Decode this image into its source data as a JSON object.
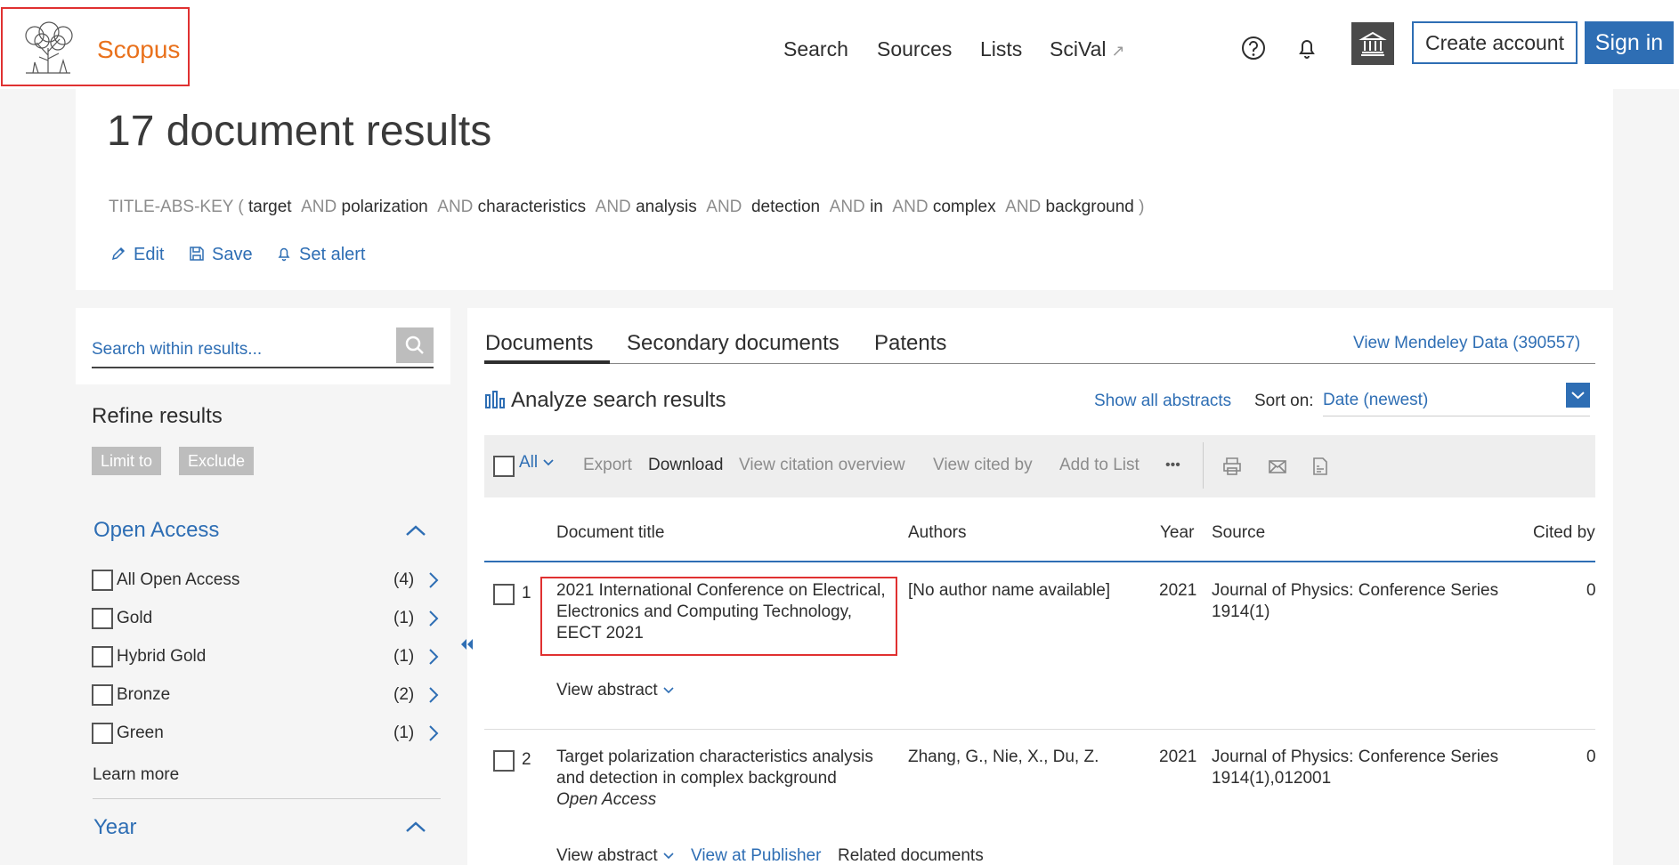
{
  "header": {
    "logo_text": "Scopus",
    "nav": [
      {
        "label": "Search"
      },
      {
        "label": "Sources"
      },
      {
        "label": "Lists"
      },
      {
        "label": "SciVal",
        "external": "↗"
      }
    ],
    "create_account": "Create account",
    "sign_in": "Sign in",
    "icons": [
      "help-icon",
      "bell-icon",
      "institution-icon"
    ]
  },
  "results": {
    "title": "17 document results",
    "query": {
      "field": "TITLE-ABS-KEY (",
      "terms": [
        "target",
        "polarization",
        "characteristics",
        "analysis",
        "detection",
        "in",
        "complex",
        "background"
      ],
      "op": "AND",
      "close": ")"
    },
    "actions": {
      "edit": "Edit",
      "save": "Save",
      "set_alert": "Set alert"
    }
  },
  "sidebar": {
    "search_placeholder": "Search within results...",
    "refine_title": "Refine results",
    "limit_to": "Limit to",
    "exclude": "Exclude",
    "open_access": {
      "title": "Open Access",
      "items": [
        {
          "label": "All Open Access",
          "count": "(4)"
        },
        {
          "label": "Gold",
          "count": "(1)"
        },
        {
          "label": "Hybrid Gold",
          "count": "(1)"
        },
        {
          "label": "Bronze",
          "count": "(2)"
        },
        {
          "label": "Green",
          "count": "(1)"
        }
      ],
      "learn_more": "Learn more"
    },
    "year_title": "Year"
  },
  "main": {
    "tabs": [
      {
        "label": "Documents"
      },
      {
        "label": "Secondary documents"
      },
      {
        "label": "Patents"
      }
    ],
    "mendeley": "View Mendeley Data (390557)",
    "analyze": "Analyze search results",
    "show_all_abstracts": "Show all abstracts",
    "sort_label": "Sort on:",
    "sort_value": "Date (newest)",
    "toolbar": {
      "all": "All",
      "export": "Export",
      "download": "Download",
      "view_citation": "View citation overview",
      "view_cited_by": "View cited by",
      "add_to_list": "Add to List",
      "more": "•••"
    },
    "columns": {
      "title": "Document title",
      "authors": "Authors",
      "year": "Year",
      "source": "Source",
      "cited_by": "Cited by"
    },
    "rows": [
      {
        "num": "1",
        "title_lines": [
          "2021 International Conference on Electrical,",
          "Electronics and Computing Technology,",
          "EECT 2021"
        ],
        "authors": "[No author name available]",
        "year": "2021",
        "source_lines": [
          "Journal of Physics: Conference Series",
          "1914(1)"
        ],
        "cited": "0",
        "view_abstract": "View abstract"
      },
      {
        "num": "2",
        "title_lines": [
          "Target polarization characteristics analysis",
          "and detection in complex background"
        ],
        "open_access": "Open Access",
        "authors": "Zhang, G., Nie, X., Du, Z.",
        "year": "2021",
        "source_lines": [
          "Journal of Physics: Conference Series",
          "1914(1),012001"
        ],
        "cited": "0",
        "view_abstract": "View abstract",
        "view_publisher": "View at Publisher",
        "related": "Related documents"
      }
    ]
  }
}
